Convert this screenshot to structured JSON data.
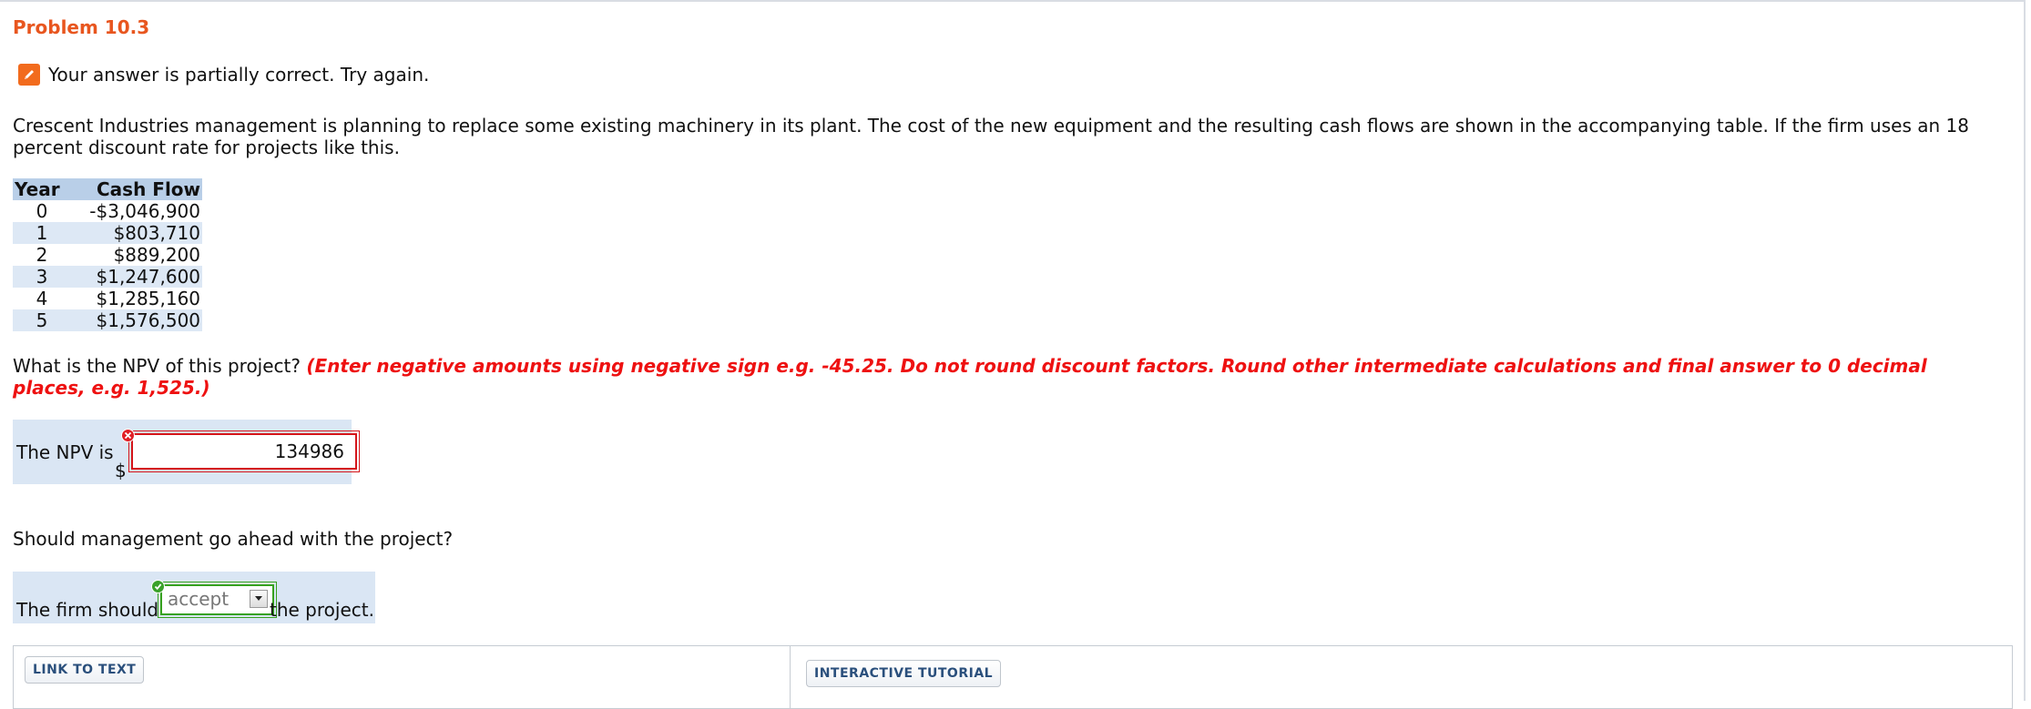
{
  "problem": {
    "title": "Problem 10.3"
  },
  "status": {
    "message": "Your answer is partially correct.  Try again."
  },
  "intro_text": "Crescent Industries management is planning to replace some existing machinery in its plant. The cost of the new equipment and the resulting cash flows are shown in the accompanying table. If the firm uses an 18 percent discount rate for projects like this.",
  "cash_flow_table": {
    "headers": [
      "Year",
      "Cash Flow"
    ],
    "rows": [
      [
        "0",
        "-$3,046,900"
      ],
      [
        "1",
        "$803,710"
      ],
      [
        "2",
        "$889,200"
      ],
      [
        "3",
        "$1,247,600"
      ],
      [
        "4",
        "$1,285,160"
      ],
      [
        "5",
        "$1,576,500"
      ]
    ]
  },
  "question1": {
    "text": "What is the NPV of this project?",
    "hint": "(Enter negative amounts using negative sign e.g. -45.25. Do not round discount factors. Round other intermediate calculations and final answer to 0 decimal places, e.g. 1,525.)"
  },
  "npv": {
    "label": "The NPV is",
    "currency": "$",
    "value": "134986",
    "state": "incorrect",
    "error_color": "#d4161b"
  },
  "question2": {
    "text": "Should management go ahead with the project?"
  },
  "firm": {
    "label": "The firm should",
    "selected": "accept",
    "suffix": "the project.",
    "state": "correct",
    "correct_color": "#37a11f"
  },
  "buttons": {
    "link_to_text": "LINK TO TEXT",
    "interactive_tutorial": "INTERACTIVE TUTORIAL"
  },
  "colors": {
    "title": "#e8561f",
    "hint": "#ee1111",
    "panel": "#dae6f4",
    "status_icon": "#f26b1d"
  }
}
